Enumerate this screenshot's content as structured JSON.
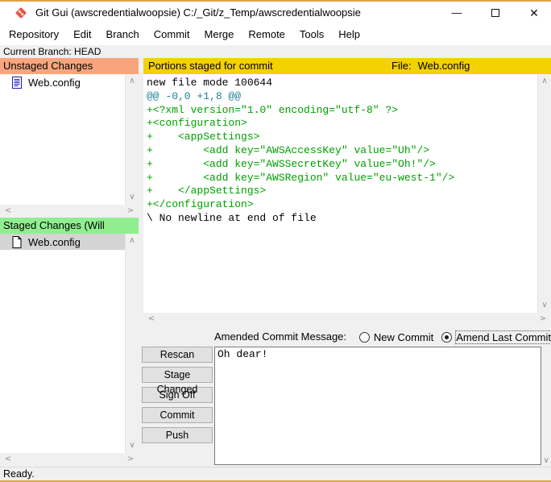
{
  "window": {
    "title": "Git Gui (awscredentialwoopsie) C:/_Git/z_Temp/awscredentialwoopsie"
  },
  "icons": {
    "minimize": "—",
    "close": "✕",
    "scroll_up": "∧",
    "scroll_down": "∨",
    "scroll_left": "<",
    "scroll_right": ">"
  },
  "menu": {
    "items": [
      "Repository",
      "Edit",
      "Branch",
      "Commit",
      "Merge",
      "Remote",
      "Tools",
      "Help"
    ]
  },
  "branch_bar": {
    "text": "Current Branch: HEAD"
  },
  "unstaged": {
    "header": "Unstaged Changes",
    "files": [
      {
        "name": "Web.config",
        "state": "plain"
      }
    ]
  },
  "staged": {
    "header": "Staged Changes (Will Commit)",
    "files": [
      {
        "name": "Web.config",
        "state": "selected"
      }
    ]
  },
  "diff": {
    "header": "Portions staged for commit",
    "file_label": "File:",
    "file_name": "Web.config",
    "lines": [
      {
        "type": "meta",
        "text": "new file mode 100644"
      },
      {
        "type": "hunk",
        "text": "@@ -0,0 +1,8 @@"
      },
      {
        "type": "add",
        "text": "+<?xml version=\"1.0\" encoding=\"utf-8\" ?>"
      },
      {
        "type": "add",
        "text": "+<configuration>"
      },
      {
        "type": "add",
        "text": "+    <appSettings>"
      },
      {
        "type": "add",
        "text": "+        <add key=\"AWSAccessKey\" value=\"Uh\"/>"
      },
      {
        "type": "add",
        "text": "+        <add key=\"AWSSecretKey\" value=\"Oh!\"/>"
      },
      {
        "type": "add",
        "text": "+        <add key=\"AWSRegion\" value=\"eu-west-1\"/>"
      },
      {
        "type": "add",
        "text": "+    </appSettings>"
      },
      {
        "type": "add",
        "text": "+</configuration>"
      },
      {
        "type": "meta",
        "text": "\\ No newline at end of file"
      }
    ]
  },
  "commit": {
    "message_label": "Amended Commit Message:",
    "radio_new": "New Commit",
    "radio_amend": "Amend Last Commit",
    "buttons": [
      "Rescan",
      "Stage Changed",
      "Sign Off",
      "Commit",
      "Push"
    ],
    "message_text": "Oh dear!"
  },
  "status_bar": {
    "text": "Ready."
  },
  "colors": {
    "unstaged_header": "#f8a57e",
    "staged_header": "#90ee90",
    "diff_header": "#f3d103",
    "diff_add": "#00a000",
    "diff_hunk": "#1c8396",
    "accent_border": "#dfa144",
    "selected_row": "#d4d4d4"
  }
}
